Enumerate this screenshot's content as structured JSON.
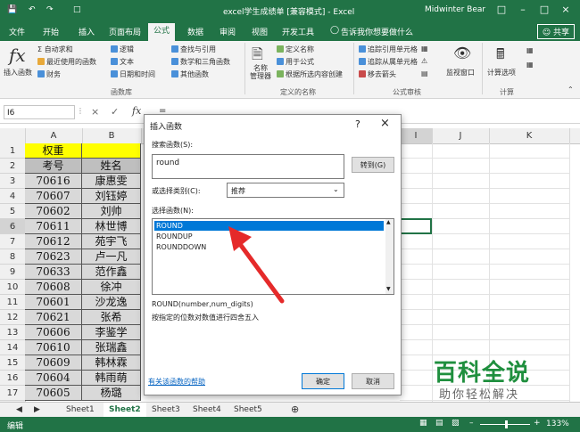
{
  "titlebar": {
    "title": "excel学生成绩单 [兼容模式] - Excel",
    "user": "Midwinter Bear",
    "autosave_icon": "save-icon",
    "undo_icon": "undo-icon",
    "redo_icon": "redo-icon"
  },
  "tabs": [
    "文件",
    "开始",
    "插入",
    "页面布局",
    "公式",
    "数据",
    "审阅",
    "视图",
    "开发工具"
  ],
  "active_tab": "公式",
  "tell_me": "告诉我你想要做什么",
  "share": "共享",
  "ribbon": {
    "insert_function": "插入函数",
    "autosum": "自动求和",
    "recent": "最近使用的函数",
    "financial": "财务",
    "logical": "逻辑",
    "text": "文本",
    "datetime": "日期和时间",
    "lookup": "查找与引用",
    "math": "数学和三角函数",
    "more": "其他函数",
    "group_library": "函数库",
    "name_manager": "名称\n管理器",
    "define_name": "定义名称",
    "use_in_formula": "用于公式",
    "create_from_sel": "根据所选内容创建",
    "group_names": "定义的名称",
    "trace_prec": "追踪引用单元格",
    "trace_dep": "追踪从属单元格",
    "remove_arrows": "移去箭头",
    "group_audit": "公式审核",
    "watch": "监视窗口",
    "calc_options": "计算选项",
    "group_calc": "计算"
  },
  "formula_bar": {
    "name_box": "I6",
    "fx": "fx",
    "value": "="
  },
  "columns": [
    "A",
    "B",
    "I",
    "J",
    "K"
  ],
  "rows": [
    "1",
    "2",
    "3",
    "4",
    "5",
    "6",
    "7",
    "8",
    "9",
    "10",
    "11",
    "12",
    "13",
    "14",
    "15",
    "16",
    "17",
    "18"
  ],
  "sheet": {
    "row1": {
      "a": "权重",
      "b": ""
    },
    "header": {
      "a": "考号",
      "b": "姓名"
    },
    "data": [
      {
        "a": "70616",
        "b": "康惠雯"
      },
      {
        "a": "70607",
        "b": "刘钰婷"
      },
      {
        "a": "70602",
        "b": "刘帅"
      },
      {
        "a": "70611",
        "b": "林世博"
      },
      {
        "a": "70612",
        "b": "苑宇飞"
      },
      {
        "a": "70623",
        "b": "卢一凡"
      },
      {
        "a": "70633",
        "b": "范作鑫"
      },
      {
        "a": "70608",
        "b": "徐冲"
      },
      {
        "a": "70601",
        "b": "沙龙逸"
      },
      {
        "a": "70621",
        "b": "张希"
      },
      {
        "a": "70606",
        "b": "李鉴学"
      },
      {
        "a": "70610",
        "b": "张瑞鑫"
      },
      {
        "a": "70609",
        "b": "韩林霖"
      },
      {
        "a": "70604",
        "b": "韩雨萌"
      },
      {
        "a": "70605",
        "b": "杨璐"
      }
    ]
  },
  "dialog": {
    "title": "插入函数",
    "help": "?",
    "close": "×",
    "search_label": "搜索函数(S):",
    "search_value": "round",
    "goto_btn": "转到(G)",
    "category_label": "或选择类别(C):",
    "category_value": "推荐",
    "list_label": "选择函数(N):",
    "functions": [
      "ROUND",
      "ROUNDUP",
      "ROUNDDOWN"
    ],
    "signature": "ROUND(number,num_digits)",
    "description": "按指定的位数对数值进行四舍五入",
    "help_link": "有关该函数的帮助",
    "ok": "确定",
    "cancel": "取消"
  },
  "sheets": [
    "Sheet1",
    "Sheet2",
    "Sheet3",
    "Sheet4",
    "Sheet5"
  ],
  "active_sheet": "Sheet2",
  "status": {
    "mode": "编辑",
    "zoom": "133%"
  },
  "watermark": {
    "title": "百科全说",
    "subtitle": "助你轻松解决"
  }
}
